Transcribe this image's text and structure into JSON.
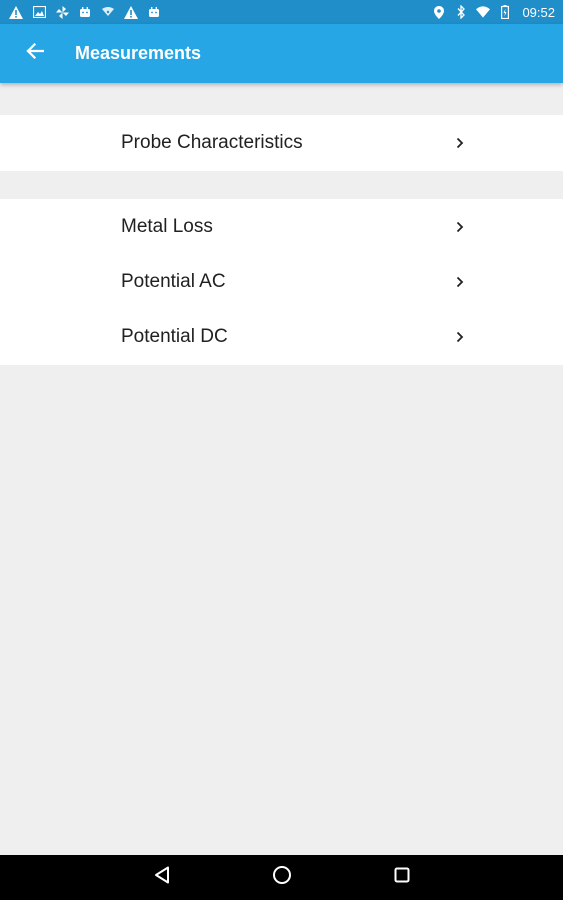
{
  "status_bar": {
    "time": "09:52",
    "left_icons": [
      "warning-icon",
      "image-icon",
      "pinwheel-icon",
      "android-icon",
      "wifi-small-icon",
      "warning-icon",
      "android-icon"
    ],
    "right_icons": [
      "location-icon",
      "bluetooth-icon",
      "wifi-icon",
      "battery-icon"
    ]
  },
  "app_bar": {
    "title": "Measurements",
    "color": "#27a6e5"
  },
  "groups": [
    {
      "items": [
        {
          "label": "Probe Characteristics"
        }
      ]
    },
    {
      "items": [
        {
          "label": "Metal Loss"
        },
        {
          "label": "Potential AC"
        },
        {
          "label": "Potential DC"
        }
      ]
    }
  ],
  "nav_bar": {
    "buttons": [
      "back-triangle-icon",
      "home-circle-icon",
      "recents-square-icon"
    ]
  }
}
